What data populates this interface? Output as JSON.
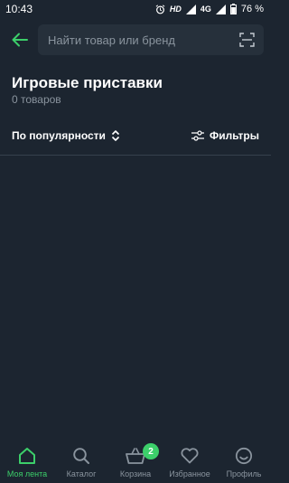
{
  "status_bar": {
    "time": "10:43",
    "hd": "HD",
    "network": "4G",
    "battery": "76 %"
  },
  "search": {
    "placeholder": "Найти товар или бренд"
  },
  "page": {
    "title": "Игровые приставки",
    "count": "0 товаров"
  },
  "sort": {
    "label": "По популярности"
  },
  "filters": {
    "label": "Фильтры"
  },
  "bottom_nav": {
    "items": [
      {
        "label": "Моя лента",
        "icon": "home-icon",
        "active": true
      },
      {
        "label": "Каталог",
        "icon": "search-icon",
        "active": false
      },
      {
        "label": "Корзина",
        "icon": "basket-icon",
        "active": false,
        "badge": "2"
      },
      {
        "label": "Избранное",
        "icon": "heart-icon",
        "active": false
      },
      {
        "label": "Профиль",
        "icon": "smiley-icon",
        "active": false
      }
    ]
  },
  "colors": {
    "background": "#1c2530",
    "accent": "#3ccf6a",
    "muted": "#8a949e"
  }
}
